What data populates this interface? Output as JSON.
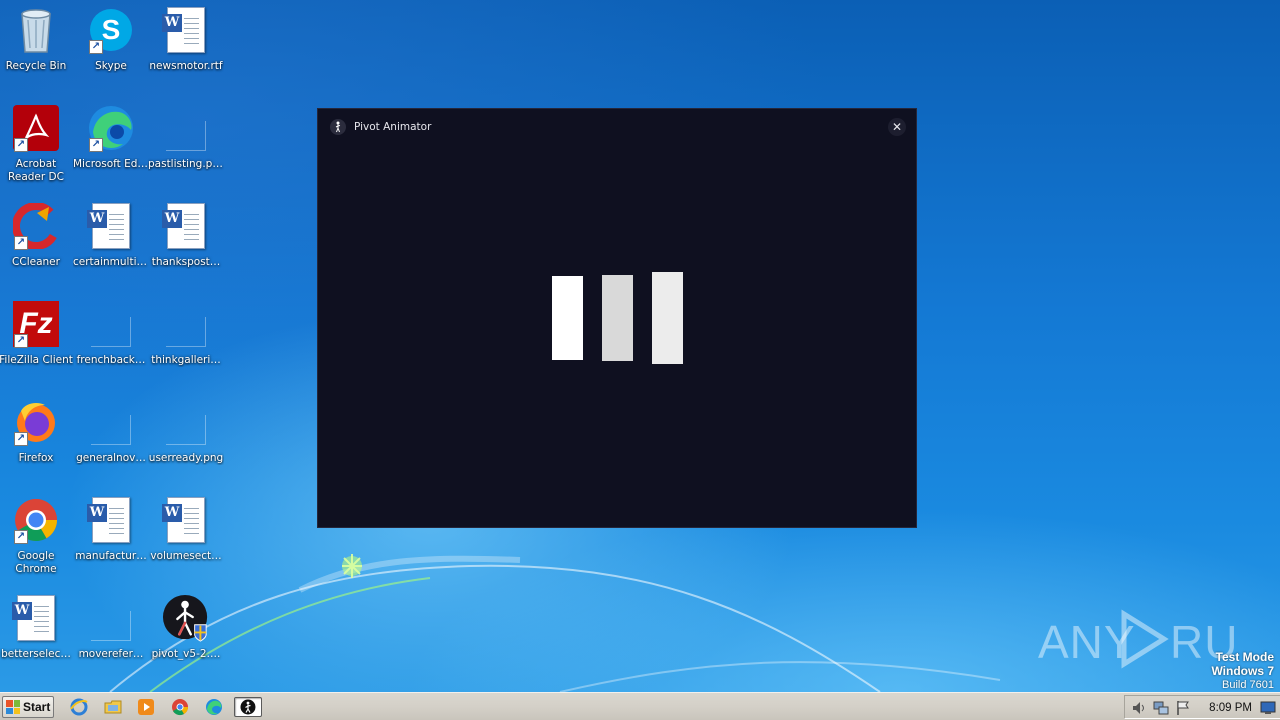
{
  "desktop": {
    "icons": [
      {
        "label": "Recycle Bin"
      },
      {
        "label": "Skype"
      },
      {
        "label": "newsmotor.rtf"
      },
      {
        "label": "Acrobat Reader DC"
      },
      {
        "label": "Microsoft Edge"
      },
      {
        "label": "pastlisting.png"
      },
      {
        "label": "CCleaner"
      },
      {
        "label": "certainmulti.rtf"
      },
      {
        "label": "thankspost…"
      },
      {
        "label": "FileZilla Client"
      },
      {
        "label": "frenchback…"
      },
      {
        "label": "thinkgalleri…"
      },
      {
        "label": "Firefox"
      },
      {
        "label": "generalnov…"
      },
      {
        "label": "userready.png"
      },
      {
        "label": "Google Chrome"
      },
      {
        "label": "manufactur…"
      },
      {
        "label": "volumesect…"
      },
      {
        "label": "betterselec…"
      },
      {
        "label": "moverefer…"
      },
      {
        "label": "pivot_v5-2…."
      }
    ]
  },
  "window": {
    "title": "Pivot Animator",
    "close_symbol": "✕",
    "loader_bar_colors": [
      "#ffffff",
      "#d9d9d9",
      "#ececec"
    ]
  },
  "watermark": {
    "brand": "ANY RUN",
    "line1": "Test Mode",
    "line2": "Windows 7",
    "line3": "Build 7601"
  },
  "taskbar": {
    "start_label": "Start",
    "clock": "8:09 PM",
    "pinned": [
      "internet-explorer-icon",
      "file-explorer-icon",
      "media-player-icon",
      "chrome-icon",
      "edge-icon",
      "pivot-animator-icon"
    ],
    "tray": [
      "volume-icon",
      "network-icon",
      "action-center-flag-icon",
      "show-desktop-icon"
    ]
  }
}
